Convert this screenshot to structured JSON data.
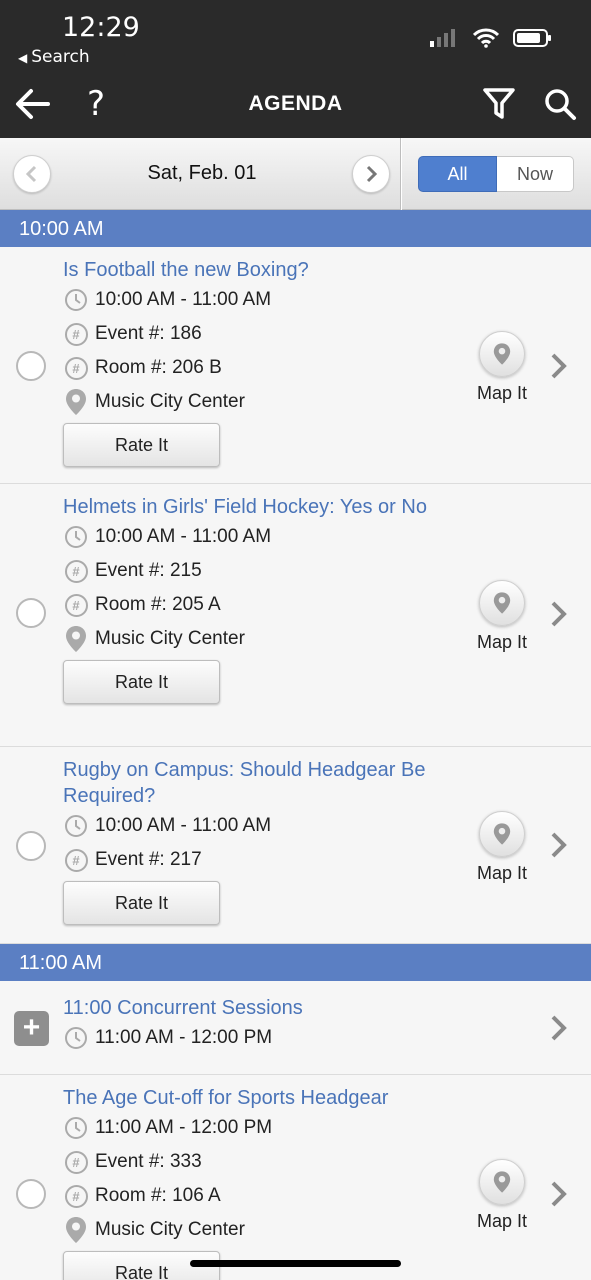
{
  "status_bar": {
    "time": "12:29",
    "back_label": "Search"
  },
  "header": {
    "title": "AGENDA"
  },
  "datebar": {
    "date": "Sat, Feb. 01",
    "segments": [
      "All",
      "Now"
    ],
    "selected": "All"
  },
  "colors": {
    "accent": "#5b7fc3",
    "link": "#4a74b8",
    "header_bg": "#2a2a2a"
  },
  "sections": [
    {
      "time": "10:00 AM",
      "items": [
        {
          "title": "Is Football the new Boxing?",
          "time": "10:00 AM - 11:00 AM",
          "event": "Event #: 186",
          "room": "Room #: 206 B",
          "location": "Music City Center",
          "rate": "Rate It",
          "map": "Map It"
        },
        {
          "title": "Helmets in Girls' Field Hockey: Yes or No",
          "time": "10:00 AM - 11:00 AM",
          "event": "Event #: 215",
          "room": "Room #: 205 A",
          "location": "Music City Center",
          "rate": "Rate It",
          "map": "Map It"
        },
        {
          "title": "Rugby on Campus: Should Headgear Be Required?",
          "time": "10:00 AM - 11:00 AM",
          "event": "Event #: 217",
          "rate": "Rate It",
          "map": "Map It"
        }
      ]
    },
    {
      "time": "11:00 AM",
      "items": [
        {
          "title": "11:00 Concurrent Sessions",
          "time": "11:00 AM - 12:00 PM"
        },
        {
          "title": "The Age Cut-off for Sports Headgear",
          "time": "11:00 AM - 12:00 PM",
          "event": "Event #: 333",
          "room": "Room #: 106 A",
          "location": "Music City Center",
          "rate": "Rate It",
          "map": "Map It"
        }
      ]
    }
  ]
}
